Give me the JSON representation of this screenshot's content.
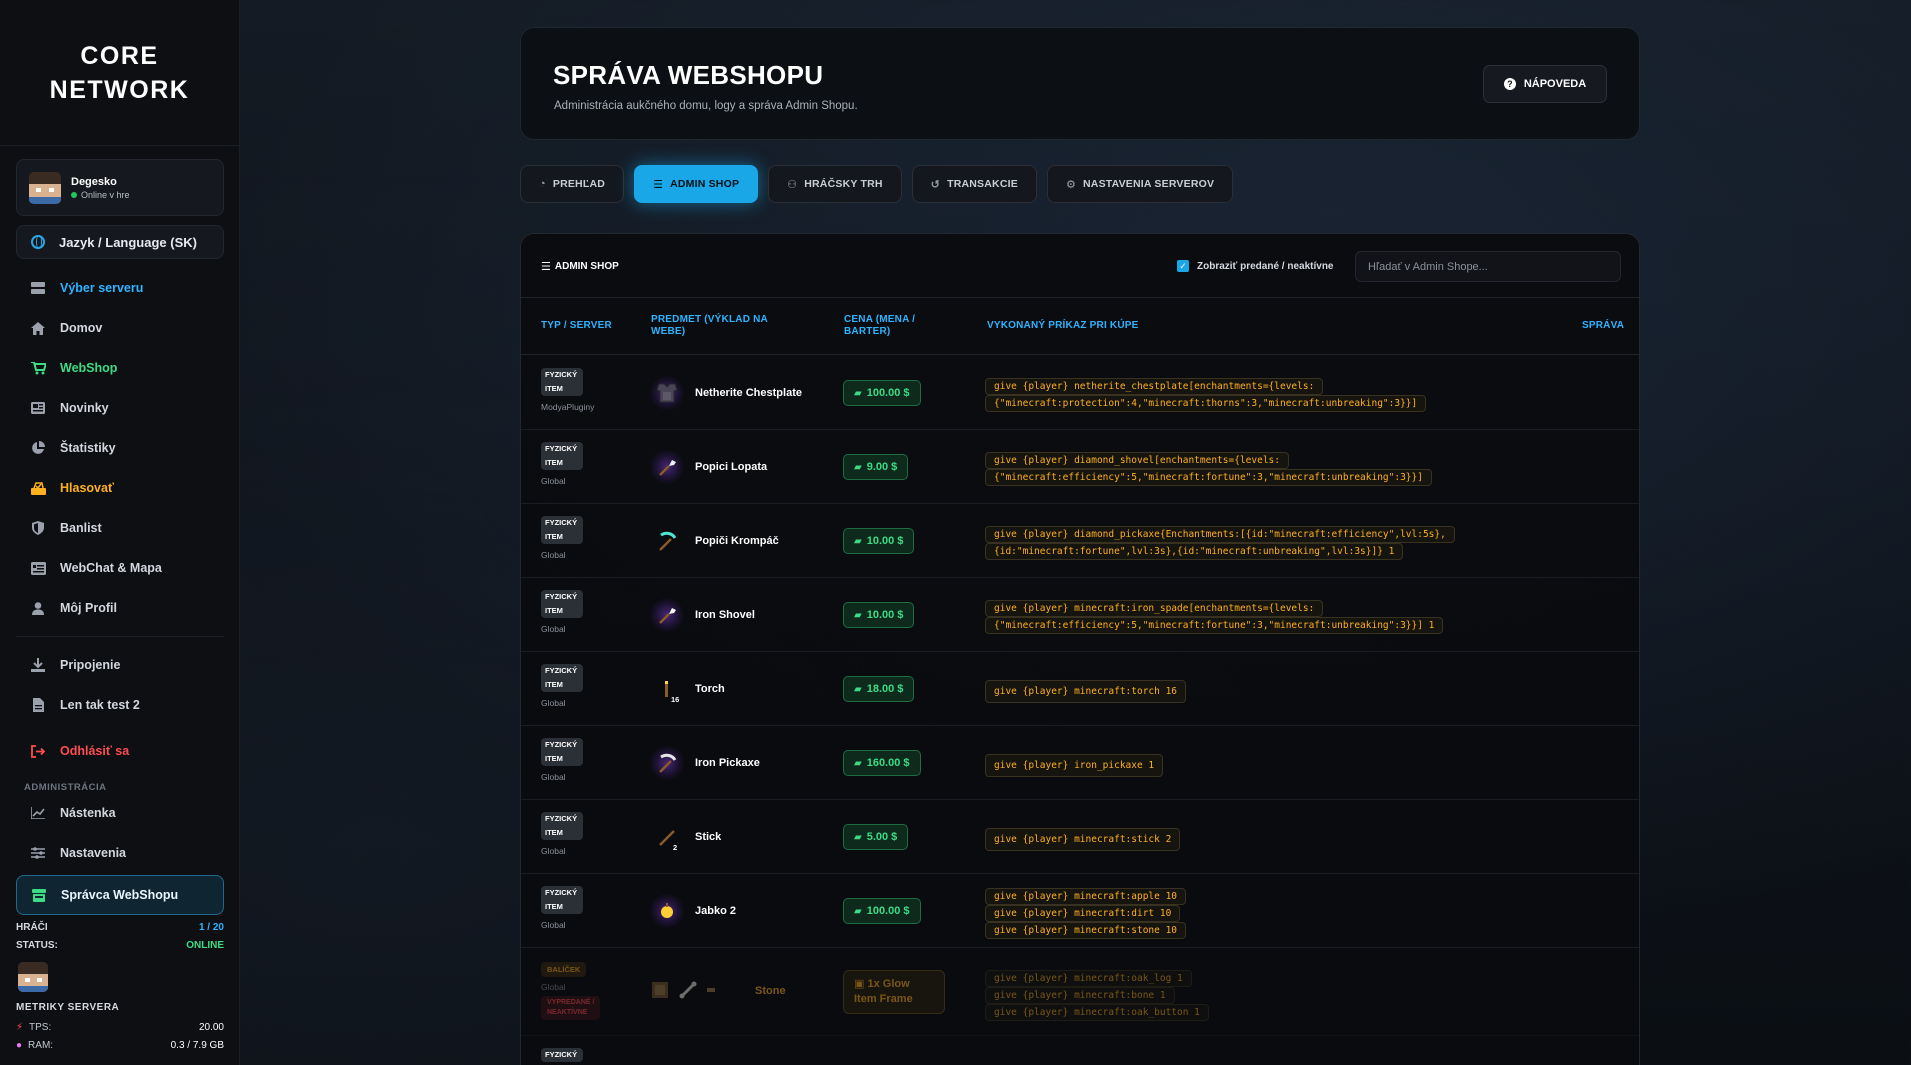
{
  "sidebar": {
    "logo_line1": "CORE",
    "logo_line2": "NETWORK",
    "user": {
      "name": "Degesko",
      "status": "Online v hre"
    },
    "language": "Jazyk / Language (SK)",
    "items": [
      {
        "label": "Výber serveru",
        "icon": "server-icon"
      },
      {
        "label": "Domov",
        "icon": "home-icon"
      },
      {
        "label": "WebShop",
        "icon": "cart-icon"
      },
      {
        "label": "Novinky",
        "icon": "news-icon"
      },
      {
        "label": "Štatistiky",
        "icon": "pie-icon"
      },
      {
        "label": "Hlasovať",
        "icon": "vote-icon"
      },
      {
        "label": "Banlist",
        "icon": "shield-icon"
      },
      {
        "label": "WebChat & Mapa",
        "icon": "chat-icon"
      },
      {
        "label": "Môj Profil",
        "icon": "user-icon"
      }
    ],
    "extra_items": [
      {
        "label": "Pripojenie",
        "icon": "download-icon"
      },
      {
        "label": "Len tak test 2",
        "icon": "file-icon"
      }
    ],
    "logout": "Odhlásiť sa",
    "admin_section": "ADMINISTRÁCIA",
    "admin_items": [
      {
        "label": "Nástenka",
        "icon": "chart-icon"
      },
      {
        "label": "Nastavenia",
        "icon": "sliders-icon"
      },
      {
        "label": "Správca WebShopu",
        "icon": "store-icon"
      }
    ],
    "stats": {
      "players_label": "HRÁČI",
      "players_value": "1 / 20",
      "status_label": "STATUS:",
      "status_value": "ONLINE",
      "metrics_title": "METRIKY SERVERA",
      "tps_label": "TPS:",
      "tps_value": "20.00",
      "ram_label": "RAM:",
      "ram_value": "0.3 / 7.9 GB"
    }
  },
  "header": {
    "title": "SPRÁVA WEBSHOPU",
    "subtitle": "Administrácia aukčného domu, logy a správa Admin Shopu.",
    "help": "NÁPOVEDA"
  },
  "tabs": [
    {
      "label": "PREHĽAD",
      "icon": "pie-icon"
    },
    {
      "label": "ADMIN SHOP",
      "icon": "list-icon",
      "active": true
    },
    {
      "label": "HRÁČSKY TRH",
      "icon": "users-icon"
    },
    {
      "label": "TRANSAKCIE",
      "icon": "history-icon"
    },
    {
      "label": "NASTAVENIA SERVEROV",
      "icon": "gear-icon"
    }
  ],
  "panel": {
    "title": "ADMIN SHOP",
    "toggle_label": "Zobraziť predané / neaktívne",
    "search_placeholder": "Hľadať v Admin Shope...",
    "columns": {
      "type": "TYP / SERVER",
      "item": "PREDMET (VÝKLAD NA WEBE)",
      "price": "CENA (MENA / BARTER)",
      "command": "VYKONANÝ PRÍKAZ PRI KÚPE",
      "manage": "SPRÁVA"
    },
    "rows": [
      {
        "type_line1": "FYZICKÝ",
        "type_line2": "ITEM",
        "server": "ModyaPluginy",
        "name": "Netherite Chestplate",
        "qty": "",
        "price": "100.00 $",
        "cmd": [
          "give {player} netherite_chestplate[enchantments={levels:",
          "{\"minecraft:protection\":4,\"minecraft:thorns\":3,\"minecraft:unbreaking\":3}}]"
        ]
      },
      {
        "type_line1": "FYZICKÝ",
        "type_line2": "ITEM",
        "server": "Global",
        "name": "Popici Lopata",
        "qty": "",
        "price": "9.00 $",
        "cmd": [
          "give {player} diamond_shovel[enchantments={levels:",
          "{\"minecraft:efficiency\":5,\"minecraft:fortune\":3,\"minecraft:unbreaking\":3}}]"
        ]
      },
      {
        "type_line1": "FYZICKÝ",
        "type_line2": "ITEM",
        "server": "Global",
        "name": "Popiči Krompáč",
        "qty": "",
        "price": "10.00 $",
        "cmd": [
          "give {player} diamond_pickaxe{Enchantments:[{id:\"minecraft:efficiency\",lvl:5s},",
          "{id:\"minecraft:fortune\",lvl:3s},{id:\"minecraft:unbreaking\",lvl:3s}]} 1"
        ]
      },
      {
        "type_line1": "FYZICKÝ",
        "type_line2": "ITEM",
        "server": "Global",
        "name": "Iron Shovel",
        "qty": "",
        "price": "10.00 $",
        "cmd": [
          "give {player} minecraft:iron_spade[enchantments={levels:",
          "{\"minecraft:efficiency\":5,\"minecraft:fortune\":3,\"minecraft:unbreaking\":3}}] 1"
        ]
      },
      {
        "type_line1": "FYZICKÝ",
        "type_line2": "ITEM",
        "server": "Global",
        "name": "Torch",
        "qty": "16",
        "price": "18.00 $",
        "cmd": [
          "give {player} minecraft:torch 16"
        ]
      },
      {
        "type_line1": "FYZICKÝ",
        "type_line2": "ITEM",
        "server": "Global",
        "name": "Iron Pickaxe",
        "qty": "",
        "price": "160.00 $",
        "cmd": [
          "give {player} iron_pickaxe 1"
        ]
      },
      {
        "type_line1": "FYZICKÝ",
        "type_line2": "ITEM",
        "server": "Global",
        "name": "Stick",
        "qty": "2",
        "price": "5.00 $",
        "cmd": [
          "give {player} minecraft:stick 2"
        ]
      },
      {
        "type_line1": "FYZICKÝ",
        "type_line2": "ITEM",
        "server": "Global",
        "name": "Jabko 2",
        "qty": "",
        "price": "100.00 $",
        "cmd": [
          "give {player} minecraft:apple 10",
          "give {player} minecraft:dirt 10",
          "give {player} minecraft:stone 10"
        ]
      }
    ],
    "bundle_row": {
      "type": "BALÍČEK",
      "server": "Global",
      "sold_line1": "VYPREDANÉ /",
      "sold_line2": "NEAKTÍVNE",
      "name": "Stone",
      "barter_line1": "1x Glow",
      "barter_line2": "Item Frame",
      "cmd": [
        "give {player} minecraft:oak_log 1",
        "give {player} minecraft:bone 1",
        "give {player} minecraft:oak_button 1"
      ]
    },
    "last_row_type": "FYZICKÝ"
  }
}
